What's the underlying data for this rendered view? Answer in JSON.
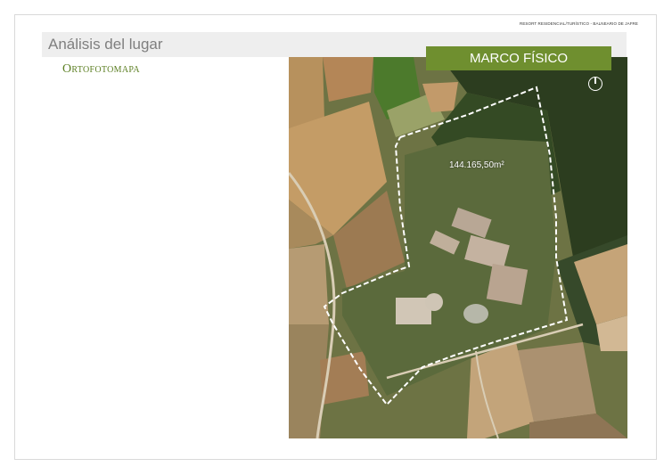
{
  "header": {
    "project": "RESORT RESIDENCIAL/TURÍSTICO - BALNEARIO DE JAFRE",
    "title": "Análisis del lugar",
    "subtitle": "Ortofotomapa"
  },
  "badge": {
    "label": "MARCO FÍSICO"
  },
  "map": {
    "area_label": "144.165,50m²",
    "north_icon": "north-arrow-icon"
  },
  "colors": {
    "badge_bg": "#6f8f2f",
    "subtitle": "#5c7f23",
    "title_bar_bg": "#eeeeee"
  }
}
